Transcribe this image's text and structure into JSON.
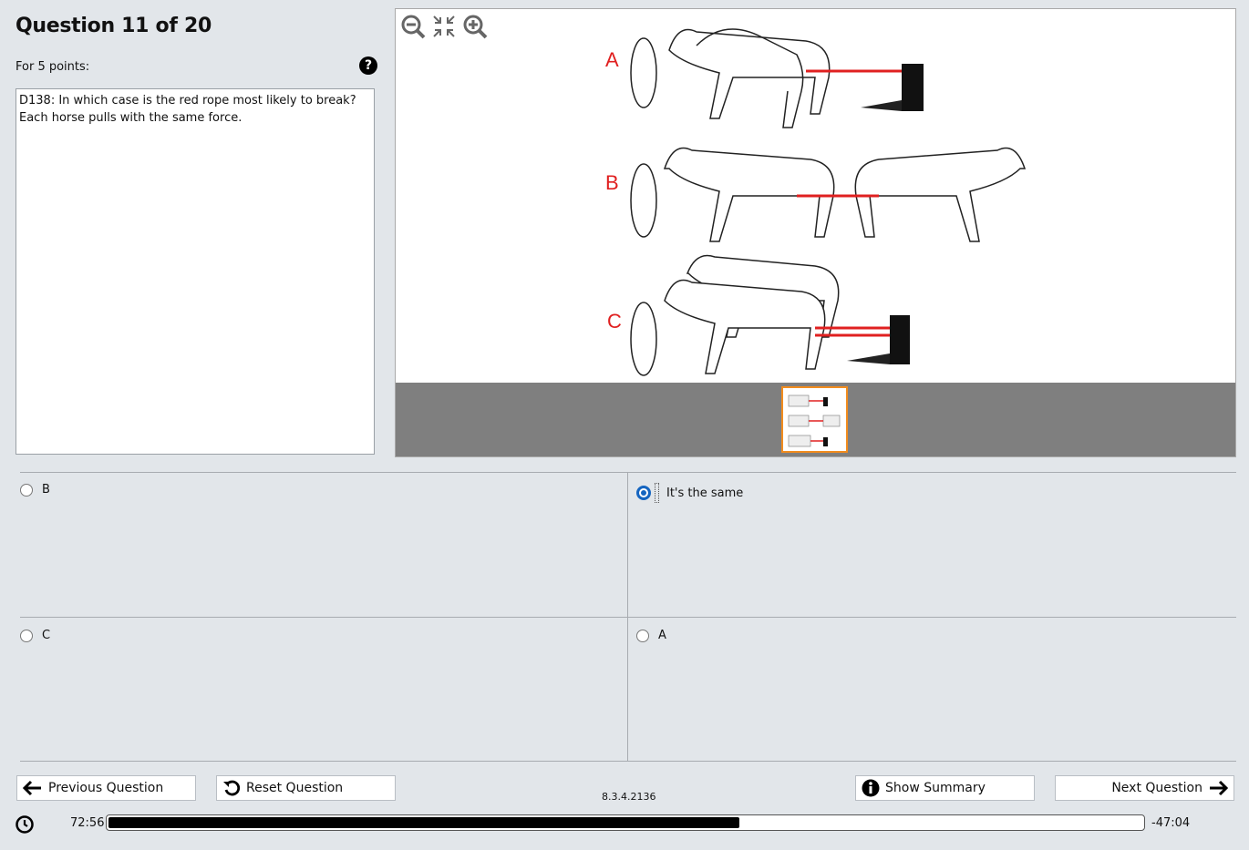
{
  "question": {
    "title": "Question 11 of 20",
    "points_label": "For 5 points:",
    "text": "D138: In which case is the red rope most likely to break?\nEach horse pulls with the same force.",
    "help_icon": "question-circle-icon"
  },
  "figure": {
    "case_labels": [
      "A",
      "B",
      "C"
    ],
    "rope_color": "#e02020",
    "label_color": "#e02020",
    "thumbnail_border": "#f28c1e",
    "toolbar_icons": [
      "zoom-out-icon",
      "fit-to-screen-icon",
      "zoom-in-icon"
    ]
  },
  "answers": [
    {
      "label": "B",
      "selected": false
    },
    {
      "label": "It's the same",
      "selected": true
    },
    {
      "label": "C",
      "selected": false
    },
    {
      "label": "A",
      "selected": false
    }
  ],
  "nav": {
    "previous_label": "Previous Question",
    "reset_label": "Reset Question",
    "summary_label": "Show Summary",
    "next_label": "Next Question",
    "version": "8.3.4.2136"
  },
  "timer": {
    "elapsed": "72:56",
    "remaining": "-47:04",
    "progress_fraction": 0.61
  }
}
